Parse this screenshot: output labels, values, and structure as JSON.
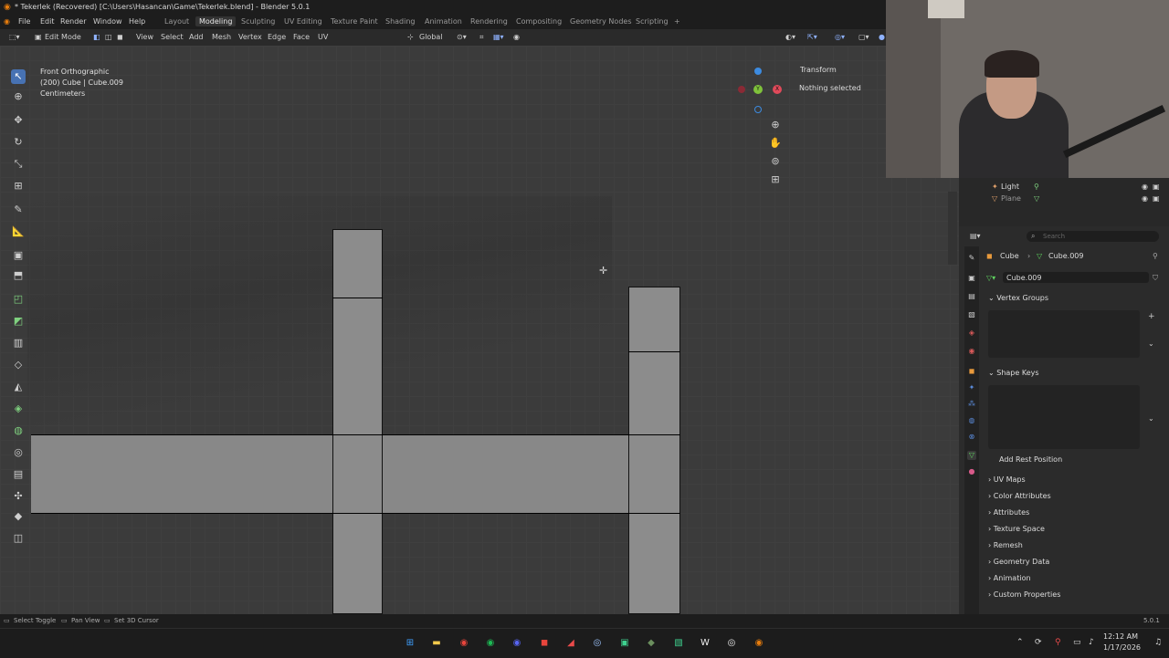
{
  "window": {
    "title": "* Tekerlek (Recovered) [C:\\Users\\Hasancan\\Game\\Tekerlek.blend] - Blender 5.0.1"
  },
  "menu": {
    "items": [
      "File",
      "Edit",
      "Render",
      "Window",
      "Help"
    ]
  },
  "workspaces": {
    "tabs": [
      "Layout",
      "Modeling",
      "Sculpting",
      "UV Editing",
      "Texture Paint",
      "Shading",
      "Animation",
      "Rendering",
      "Compositing",
      "Geometry Nodes",
      "Scripting"
    ],
    "active": "Modeling",
    "add": "+"
  },
  "header": {
    "mode": "Edit Mode",
    "menus": [
      "View",
      "Select",
      "Add",
      "Mesh",
      "Vertex",
      "Edge",
      "Face",
      "UV"
    ],
    "orientation": "Global"
  },
  "viewport": {
    "view_name": "Front Orthographic",
    "object_info": "(200) Cube | Cube.009",
    "units": "Centimeters"
  },
  "gizmo": {
    "y": "Y",
    "x": "X",
    "z": "Z"
  },
  "npanel": {
    "title": "Transform",
    "status": "Nothing selected"
  },
  "outliner": {
    "items": [
      {
        "label": "Light"
      },
      {
        "label": "Plane"
      }
    ]
  },
  "properties": {
    "search_placeholder": "Search",
    "breadcrumb_object": "Cube",
    "breadcrumb_data": "Cube.009",
    "data_name": "Cube.009",
    "sections": {
      "vertex_groups": "Vertex Groups",
      "shape_keys": "Shape Keys",
      "add_rest_position": "Add Rest Position",
      "collapsed": [
        "UV Maps",
        "Color Attributes",
        "Attributes",
        "Texture Space",
        "Remesh",
        "Geometry Data",
        "Animation",
        "Custom Properties"
      ]
    }
  },
  "statusbar": {
    "hints": [
      "Select Toggle",
      "Pan View",
      "Set 3D Cursor"
    ],
    "version": "5.0.1"
  },
  "taskbar": {
    "time": "12:12 AM",
    "date": "1/17/2026"
  },
  "colors": {
    "accent": "#4772b3",
    "viewport_bg": "#3b3b3b",
    "mesh_face": "#888888"
  }
}
